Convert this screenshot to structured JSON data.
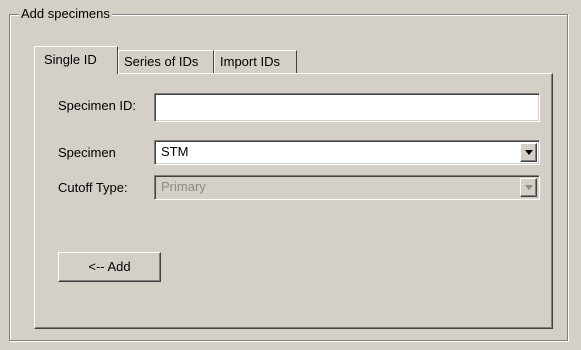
{
  "group": {
    "title": "Add specimens"
  },
  "tabs": [
    {
      "label": "Single ID",
      "active": true
    },
    {
      "label": "Series of IDs",
      "active": false
    },
    {
      "label": "Import IDs",
      "active": false
    }
  ],
  "form": {
    "specimen_id": {
      "label": "Specimen ID:",
      "value": ""
    },
    "specimen": {
      "label": "Specimen",
      "value": "STM"
    },
    "cutoff_type": {
      "label": "Cutoff Type:",
      "value": "Primary",
      "enabled": false
    }
  },
  "add_button": {
    "label": "<-- Add"
  },
  "icons": {
    "dropdown": "chevron-down-icon"
  },
  "colors": {
    "face": "#d4d0c8",
    "disabled_text": "#808080"
  }
}
